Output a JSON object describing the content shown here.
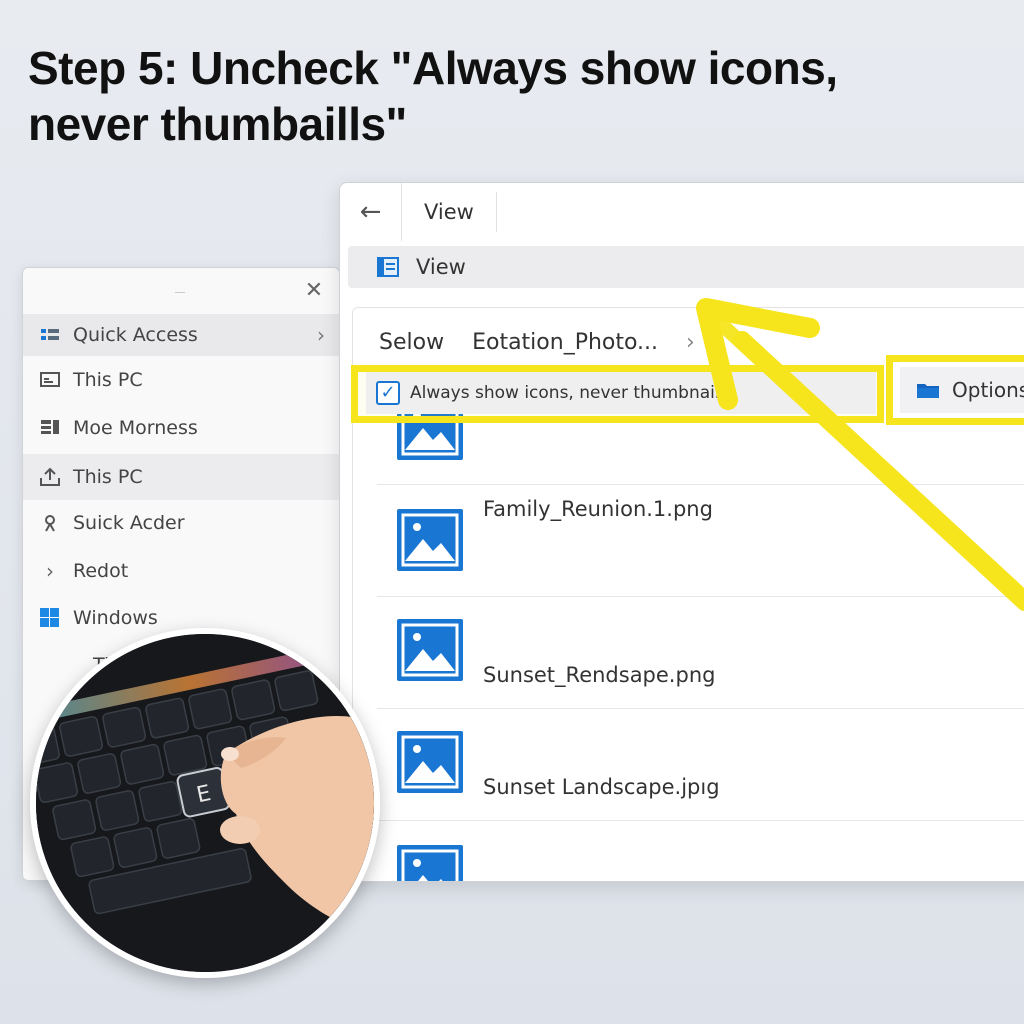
{
  "title": "Step 5: Uncheck \"Always show icons, never thumbaills\"",
  "nav": {
    "close_icon": "close-icon",
    "items": [
      {
        "label": "Quick Access",
        "icon": "quick-access-icon",
        "selected": true,
        "has_arrow": true,
        "arrow": "›"
      },
      {
        "label": "This PC",
        "icon": "pc-icon"
      },
      {
        "label": "Moe Morness",
        "icon": "document-icon"
      },
      {
        "label": "This PC",
        "icon": "upload-icon",
        "hover": true
      },
      {
        "label": "Suick Acder",
        "icon": "pin-icon"
      },
      {
        "label": "Redot",
        "icon": "chevron-right-icon",
        "prefix": "›"
      },
      {
        "label": "Windows",
        "icon": "windows-icon"
      },
      {
        "label": "Ti",
        "icon": ""
      }
    ]
  },
  "main": {
    "back_glyph": "←",
    "top_title": "View",
    "ribbon_label": "View",
    "crumbs": [
      "Selow",
      "Eotation_Photo..."
    ],
    "crumb_chevron": "›",
    "checkbox_label": "Always show icons, never thumbnails",
    "checkbox_checked": true,
    "checkbox_glyph": "✓",
    "options_label": "Options",
    "files": [
      {
        "name": ""
      },
      {
        "name": "Family_Reunion.1.png"
      },
      {
        "name": "Sunset_Rendsape.png"
      },
      {
        "name": "Sunset Landscape.jpıg"
      },
      {
        "name": ""
      }
    ]
  },
  "photo_key_label": "E",
  "colors": {
    "highlight": "#f6e51c",
    "accent": "#1976d2"
  }
}
